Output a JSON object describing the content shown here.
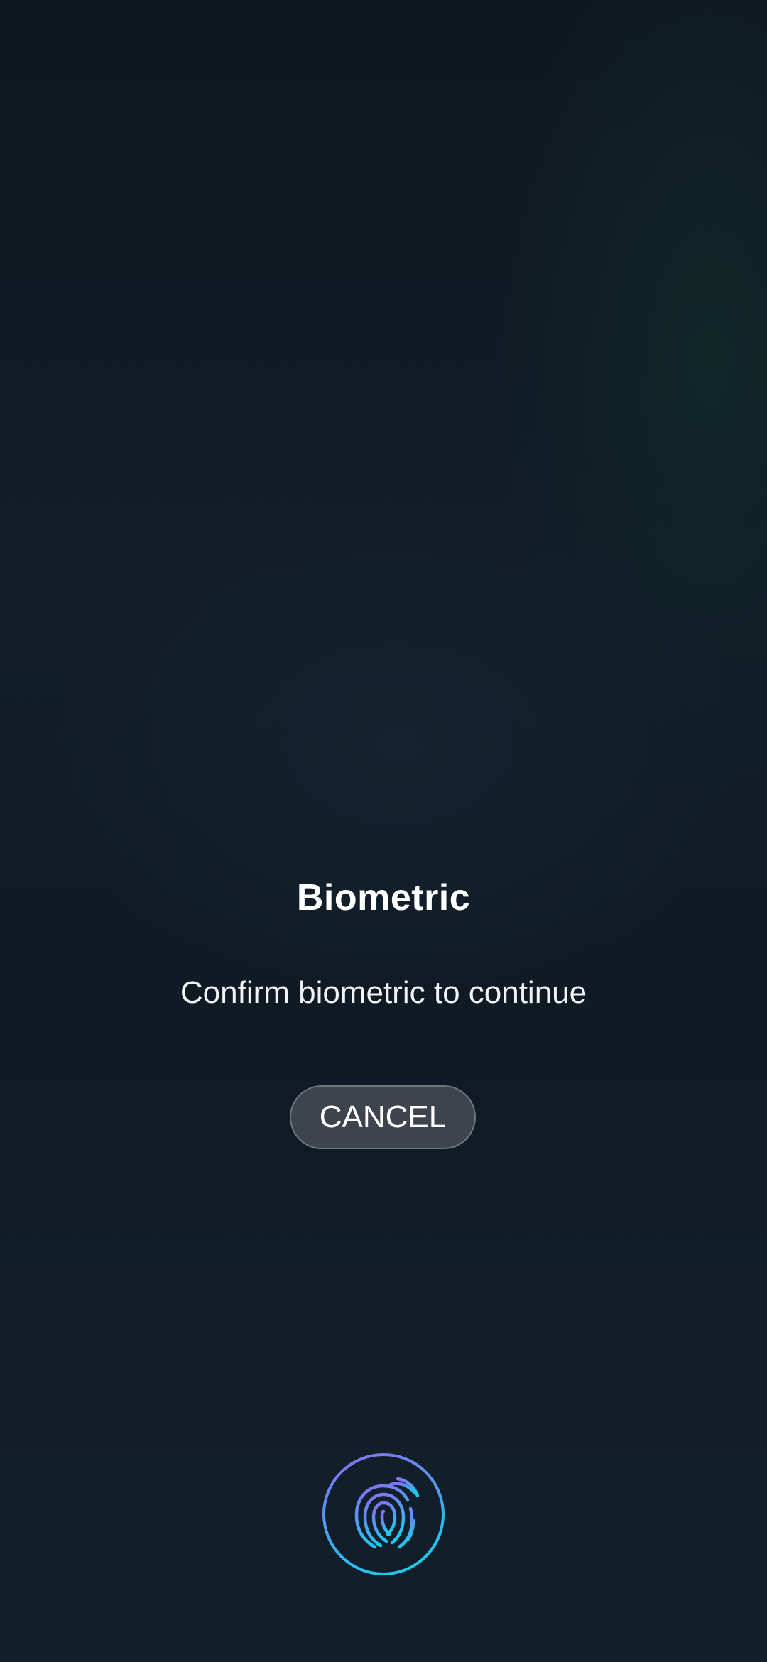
{
  "prompt": {
    "title": "Biometric",
    "subtitle": "Confirm biometric to continue",
    "cancel_label": "CANCEL"
  },
  "sensor": {
    "icon": "fingerprint-icon",
    "gradient_start": "#8a6cf0",
    "gradient_end": "#1ec8ee"
  },
  "colors": {
    "background": "#101923",
    "button_background": "#3e444d",
    "button_border": "#70767e",
    "text": "#ffffff"
  }
}
